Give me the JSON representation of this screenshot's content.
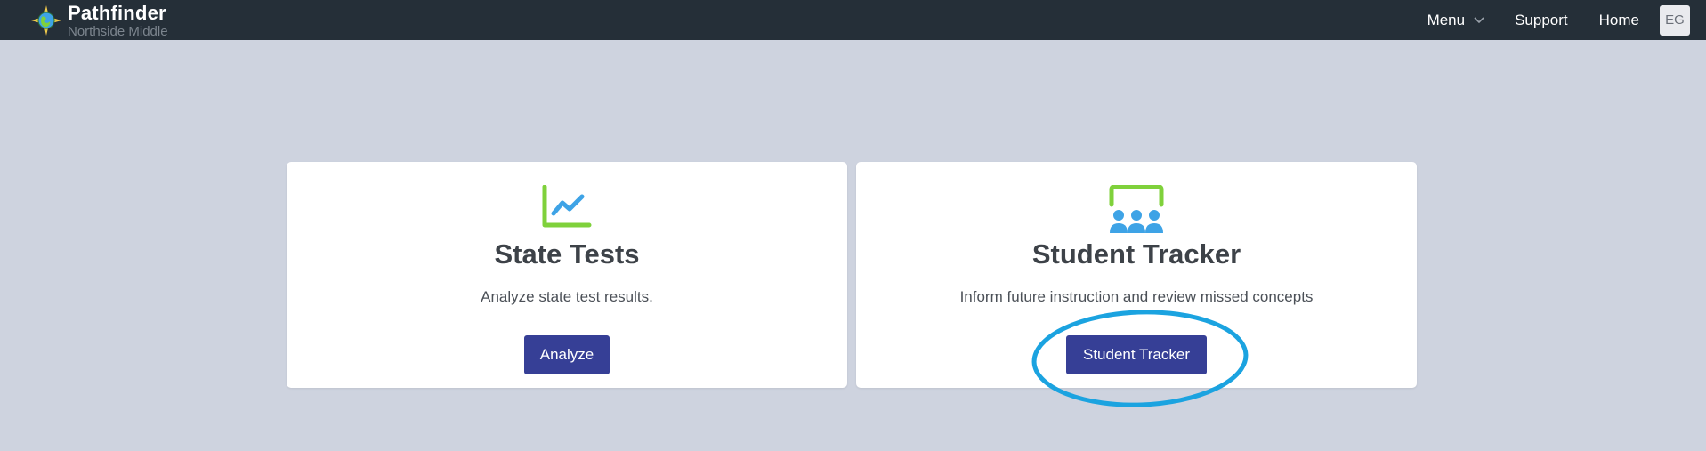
{
  "header": {
    "app_name": "Pathfinder",
    "school": "Northside Middle",
    "nav": {
      "menu": "Menu",
      "support": "Support",
      "home": "Home"
    },
    "avatar_initials": "EG",
    "logo_icon": "compass-globe-icon"
  },
  "cards": [
    {
      "icon": "line-chart-icon",
      "title": "State Tests",
      "description": "Analyze state test results.",
      "button": "Analyze"
    },
    {
      "icon": "classroom-icon",
      "title": "Student Tracker",
      "description": "Inform future instruction and review missed concepts",
      "button": "Student Tracker"
    }
  ],
  "colors": {
    "topbar": "#252f38",
    "background": "#ced3df",
    "button": "#363f96",
    "icon_green": "#7fd13b",
    "icon_blue": "#3ea3e6",
    "highlight_ring": "#1ba3e0"
  }
}
